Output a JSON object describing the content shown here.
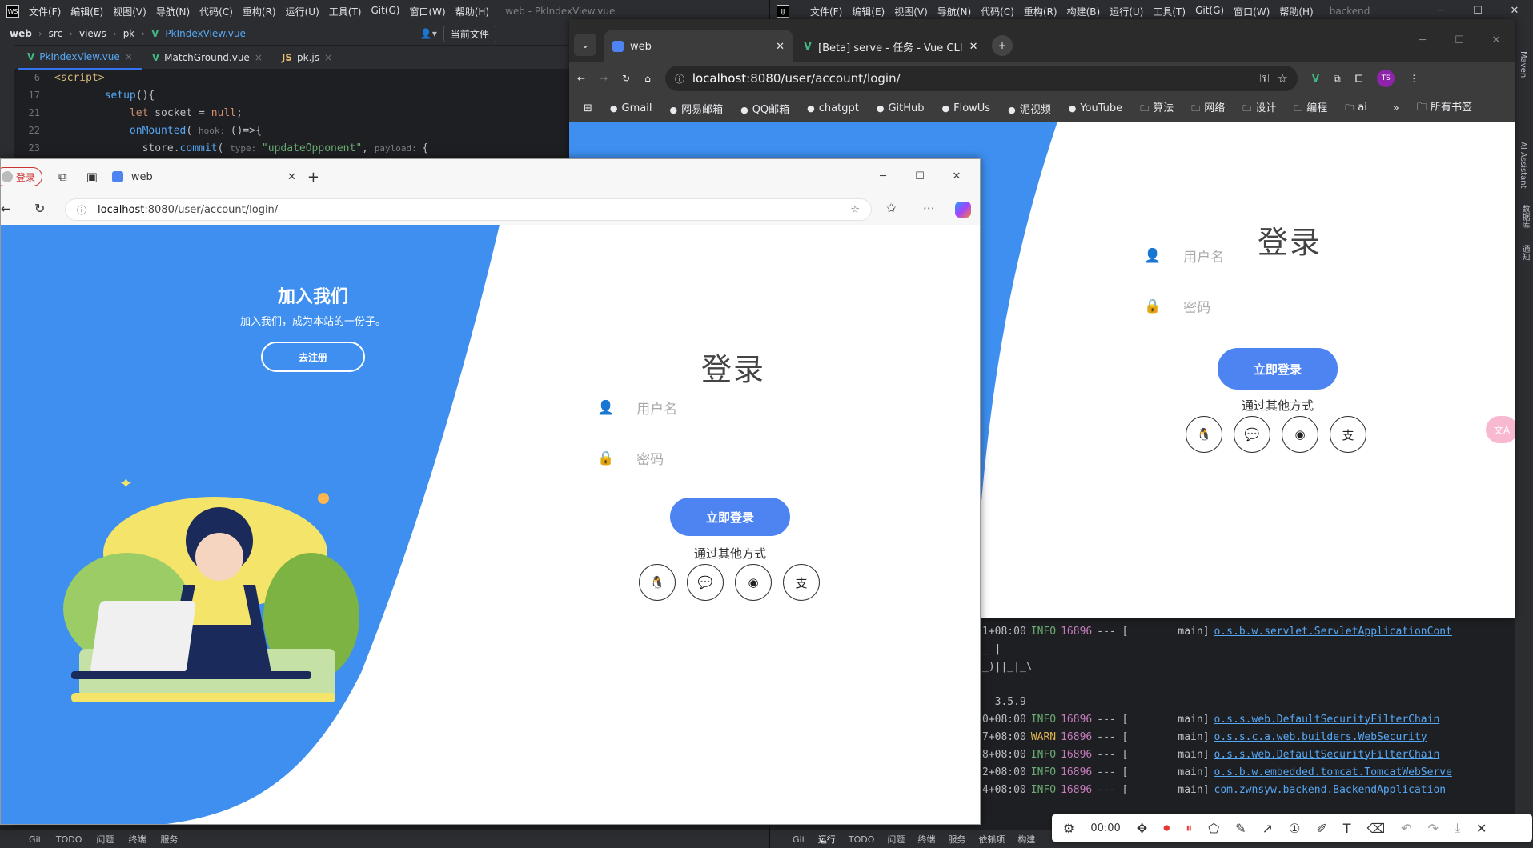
{
  "ide_left": {
    "logo": "WS",
    "menu": [
      "文件(F)",
      "编辑(E)",
      "视图(V)",
      "导航(N)",
      "代码(C)",
      "重构(R)",
      "运行(U)",
      "工具(T)",
      "Git(G)",
      "窗口(W)",
      "帮助(H)"
    ],
    "title": "web - PkIndexView.vue",
    "breadcrumb": [
      "web",
      "src",
      "views",
      "pk",
      "PkIndexView.vue"
    ],
    "current_file": "当前文件",
    "tabs": [
      "PkIndexView.vue",
      "MatchGround.vue",
      "pk.js"
    ],
    "code": [
      {
        "ln": "6",
        "parts": [
          {
            "t": "<script>",
            "c": "tag"
          }
        ]
      },
      {
        "ln": "17",
        "parts": [
          {
            "t": "        "
          },
          {
            "t": "setup",
            "c": "fn"
          },
          {
            "t": "(){"
          }
        ]
      },
      {
        "ln": "21",
        "parts": [
          {
            "t": "            "
          },
          {
            "t": "let ",
            "c": "kw"
          },
          {
            "t": "socket = "
          },
          {
            "t": "null",
            "c": "kw"
          },
          {
            "t": ";"
          }
        ]
      },
      {
        "ln": "22",
        "parts": [
          {
            "t": "            "
          },
          {
            "t": "onMounted",
            "c": "fn"
          },
          {
            "t": "( "
          },
          {
            "t": "hook: ",
            "c": "hint"
          },
          {
            "t": "()=>{"
          }
        ]
      },
      {
        "ln": "23",
        "parts": [
          {
            "t": "              store."
          },
          {
            "t": "commit",
            "c": "fn"
          },
          {
            "t": "( "
          },
          {
            "t": "type: ",
            "c": "hint"
          },
          {
            "t": "\"updateOpponent\"",
            "c": "str"
          },
          {
            "t": ", "
          },
          {
            "t": "payload: ",
            "c": "hint"
          },
          {
            "t": "{"
          }
        ]
      }
    ],
    "status": [
      "Git",
      "TODO",
      "问题",
      "终端",
      "服务"
    ]
  },
  "ide_right": {
    "logo": "IJ",
    "menu": [
      "文件(F)",
      "编辑(E)",
      "视图(V)",
      "导航(N)",
      "代码(C)",
      "重构(R)",
      "构建(B)",
      "运行(U)",
      "工具(T)",
      "Git(G)",
      "窗口(W)",
      "帮助(H)"
    ],
    "title": "backend",
    "side_labels": [
      "Maven",
      "AI Assistant",
      "数据库",
      "通知"
    ],
    "console": [
      {
        "time": "1+08:00",
        "level": "INFO",
        "pid": "16896",
        "sep": "--- [",
        "thread": "main]",
        "cls": "o.s.b.w.servlet.ServletApplicationCont"
      },
      {
        "time": "_ |",
        "level": "",
        "pid": "",
        "sep": "",
        "thread": "",
        "cls": ""
      },
      {
        "time": "_)||_|_\\",
        "level": "",
        "pid": "",
        "sep": "",
        "thread": "",
        "cls": ""
      },
      {
        "time": "",
        "level": "",
        "pid": "",
        "sep": "",
        "thread": "",
        "cls": ""
      },
      {
        "time": "  3.5.9",
        "level": "",
        "pid": "",
        "sep": "",
        "thread": "",
        "cls": ""
      },
      {
        "time": "0+08:00",
        "level": "INFO",
        "pid": "16896",
        "sep": "--- [",
        "thread": "main]",
        "cls": "o.s.s.web.DefaultSecurityFilterChain"
      },
      {
        "time": "7+08:00",
        "level": "WARN",
        "pid": "16896",
        "sep": "--- [",
        "thread": "main]",
        "cls": "o.s.s.c.a.web.builders.WebSecurity"
      },
      {
        "time": "8+08:00",
        "level": "INFO",
        "pid": "16896",
        "sep": "--- [",
        "thread": "main]",
        "cls": "o.s.s.web.DefaultSecurityFilterChain"
      },
      {
        "time": "2+08:00",
        "level": "INFO",
        "pid": "16896",
        "sep": "--- [",
        "thread": "main]",
        "cls": "o.s.b.w.embedded.tomcat.TomcatWebServe"
      },
      {
        "time": "4+08:00",
        "level": "INFO",
        "pid": "16896",
        "sep": "--- [",
        "thread": "main]",
        "cls": "com.zwnsyw.backend.BackendApplication"
      }
    ],
    "status": [
      "Git",
      "运行",
      "TODO",
      "问题",
      "终端",
      "服务",
      "依赖项",
      "构建"
    ]
  },
  "chrome": {
    "tabs": [
      {
        "label": "web",
        "active": true
      },
      {
        "label": "[Beta] serve - 任务 - Vue CLI",
        "active": false
      }
    ],
    "url_host": "localhost",
    "url_rest": ":8080/user/account/login/",
    "bookmarks": [
      "Gmail",
      "网易邮箱",
      "QQ邮箱",
      "chatgpt",
      "GitHub",
      "FlowUs",
      "泥视频",
      "YouTube",
      "算法",
      "网络",
      "设计",
      "编程",
      "ai"
    ],
    "all_bookmarks": "所有书签",
    "profile": "TS"
  },
  "edge": {
    "profile_label": "登录",
    "tab_label": "web",
    "url_host": "localhost",
    "url_rest": ":8080/user/account/login/"
  },
  "login": {
    "title": "登录",
    "username_placeholder": "用户名",
    "password_placeholder": "密码",
    "submit": "立即登录",
    "other_methods": "通过其他方式",
    "social": [
      {
        "icon": "qq-icon",
        "glyph": "🐧"
      },
      {
        "icon": "wechat-icon",
        "glyph": "💬"
      },
      {
        "icon": "weibo-icon",
        "glyph": "◉"
      },
      {
        "icon": "alipay-icon",
        "glyph": "支"
      }
    ]
  },
  "signup": {
    "title": "加入我们",
    "subtitle": "加入我们，成为本站的一份子。",
    "button": "去注册"
  },
  "screenshot_toolbar": {
    "timer": "00:00"
  },
  "colors": {
    "brand_blue": "#3e8ff0",
    "button_blue": "#4d84f1",
    "ide_bg": "#1e1f22"
  }
}
